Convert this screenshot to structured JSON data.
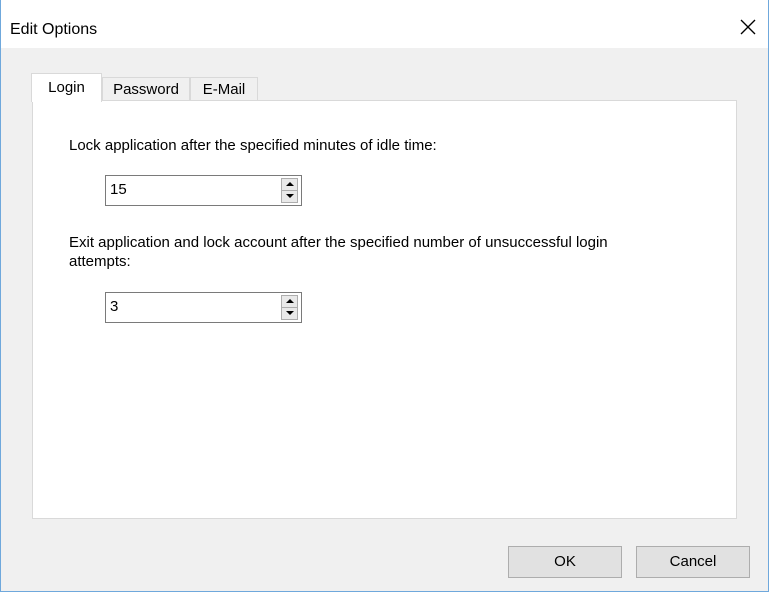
{
  "window": {
    "title": "Edit Options",
    "close_glyph": "×"
  },
  "tabs": [
    {
      "label": "Login",
      "active": true
    },
    {
      "label": "Password",
      "active": false
    },
    {
      "label": "E-Mail",
      "active": false
    }
  ],
  "login": {
    "idle_label": "Lock application after the specified minutes of idle time:",
    "idle_value": "15",
    "attempts_label_line1": "Exit application and lock account after the specified number of unsuccessful login",
    "attempts_label_line2": "attempts:",
    "attempts_value": "3"
  },
  "buttons": {
    "ok": "OK",
    "cancel": "Cancel"
  },
  "icons": {
    "close": "close-icon",
    "spin_up": "spin-up-arrow-icon",
    "spin_down": "spin-down-arrow-icon"
  },
  "colors": {
    "window_bg": "#f0f0f0",
    "panel_bg": "#ffffff",
    "button_bg": "#e1e1e1",
    "border": "#adadad"
  }
}
